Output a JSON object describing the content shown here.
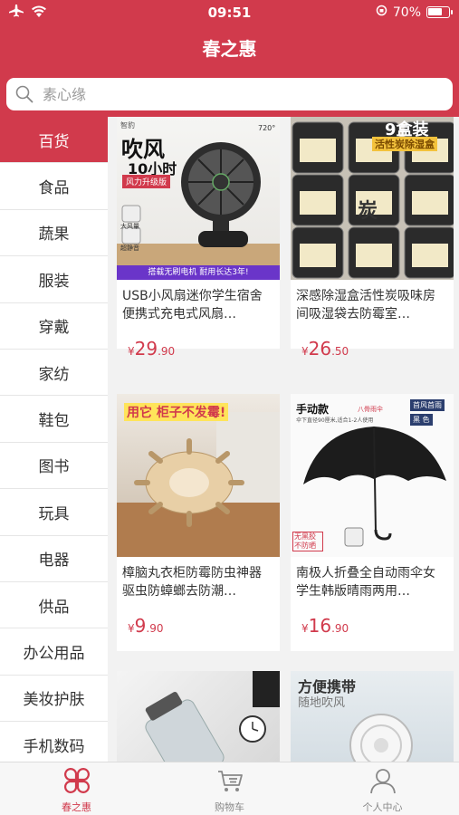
{
  "status": {
    "time": "09:51",
    "battery": "70%",
    "battery_level": 0.7
  },
  "app": {
    "title": "春之惠"
  },
  "search": {
    "placeholder": "素心缘"
  },
  "sidebar": {
    "items": [
      {
        "label": "百货"
      },
      {
        "label": "食品"
      },
      {
        "label": "蔬果"
      },
      {
        "label": "服装"
      },
      {
        "label": "穿戴"
      },
      {
        "label": "家纺"
      },
      {
        "label": "鞋包"
      },
      {
        "label": "图书"
      },
      {
        "label": "玩具"
      },
      {
        "label": "电器"
      },
      {
        "label": "供品"
      },
      {
        "label": "办公用品"
      },
      {
        "label": "美妆护肤"
      },
      {
        "label": "手机数码"
      }
    ]
  },
  "products": [
    {
      "name": "USB小风扇迷你学生宿舍便携式充电式风扇…",
      "currency": "¥",
      "price_int": "29",
      "price_dec": ".90",
      "img": {
        "title": "吹风",
        "sub": "10小时",
        "tag": "风力升级版",
        "badge": "720°",
        "feature1": "大风量",
        "feature2": "超静音",
        "banner": "搭载无刷电机 耐用长达3年!",
        "brand": "智豹"
      }
    },
    {
      "name": "深感除湿盒活性炭吸味房间吸湿袋去防霉室…",
      "currency": "¥",
      "price_int": "26",
      "price_dec": ".50",
      "img": {
        "title": "9盒装",
        "sub": "活性炭除湿盒",
        "char": "炭"
      }
    },
    {
      "name": "樟脑丸衣柜防霉防虫神器驱虫防蟑螂去防潮…",
      "currency": "¥",
      "price_int": "9",
      "price_dec": ".90",
      "img": {
        "title": "用它 柜子不发霉!"
      }
    },
    {
      "name": "南极人折叠全自动雨伞女学生韩版晴雨两用…",
      "currency": "¥",
      "price_int": "16",
      "price_dec": ".90",
      "img": {
        "title": "手动款",
        "sub": "伞下直径90厘米,适合1-2人使用",
        "ribs": "八骨雨伞",
        "tag1": "首风首雨",
        "tag2": "黑 色",
        "corner": "无黑胶 不防晒"
      }
    },
    {
      "name": "",
      "currency": "",
      "price_int": "",
      "price_dec": "",
      "img": {}
    },
    {
      "name": "",
      "currency": "",
      "price_int": "",
      "price_dec": "",
      "img": {
        "title": "方便携带",
        "sub": "随地吹风"
      }
    }
  ],
  "tabbar": {
    "items": [
      {
        "label": "春之惠"
      },
      {
        "label": "购物车"
      },
      {
        "label": "个人中心"
      }
    ]
  },
  "colors": {
    "brand": "#d13a4c",
    "price": "#d13a4c"
  }
}
